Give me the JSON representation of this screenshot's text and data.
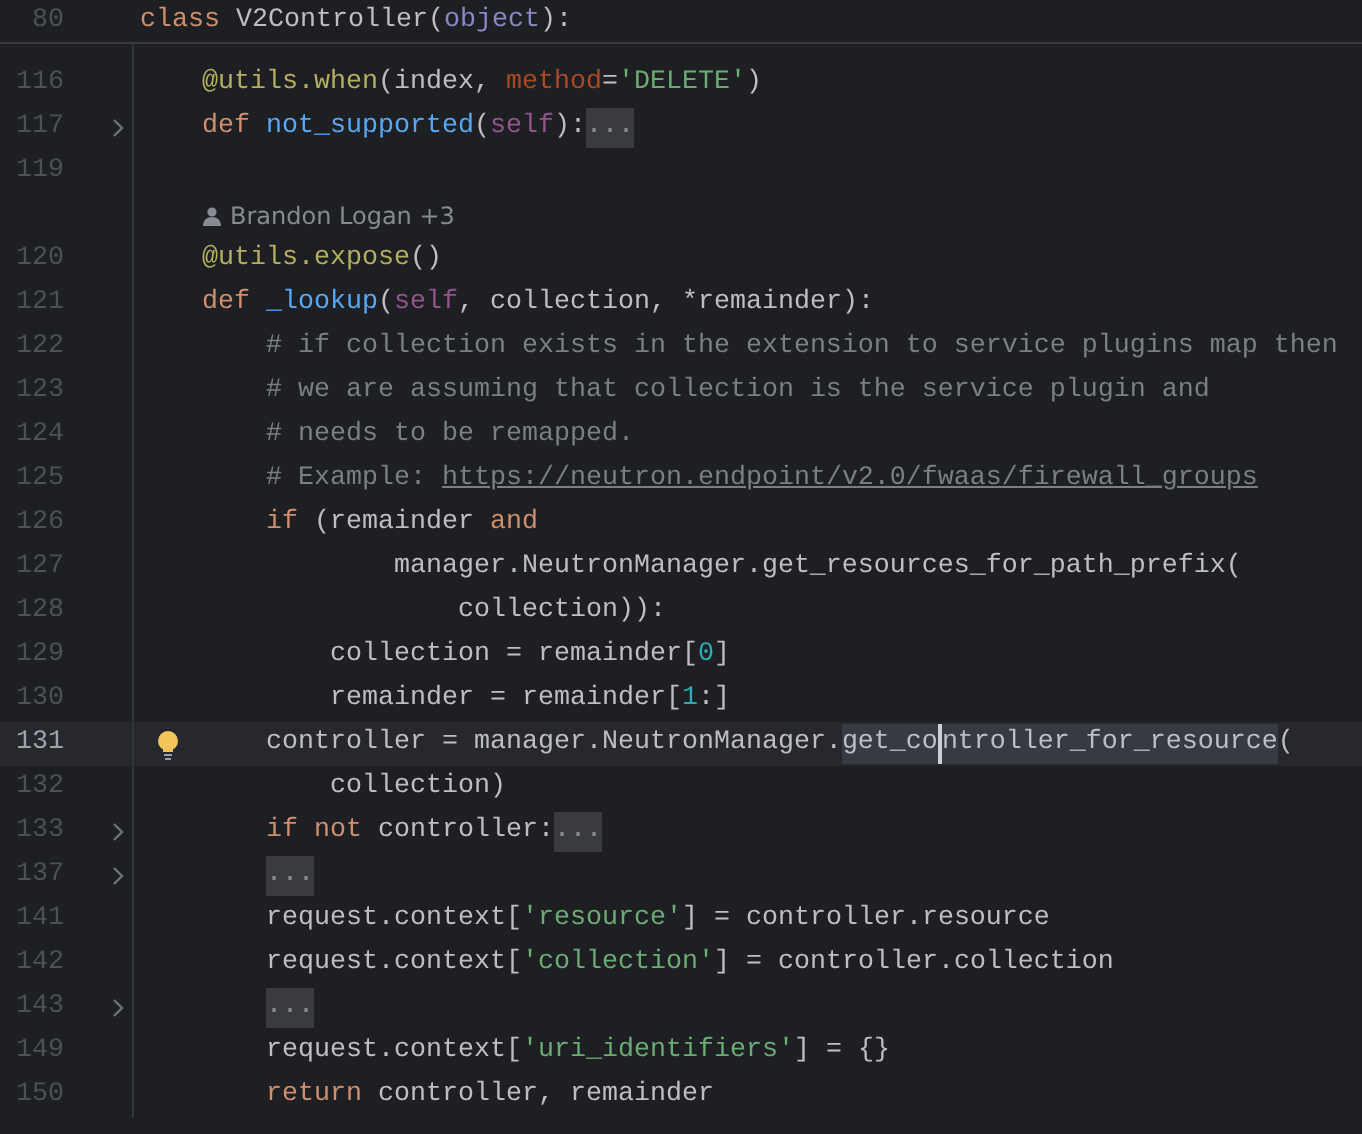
{
  "sticky_header": {
    "number": "80",
    "tokens": [
      {
        "text": "class ",
        "kind": "kw"
      },
      {
        "text": "V2Controller(",
        "kind": "plain"
      },
      {
        "text": "object",
        "kind": "builtin"
      },
      {
        "text": "):",
        "kind": "plain"
      }
    ]
  },
  "lines": [
    {
      "kind": "code",
      "number": "116",
      "fold": false,
      "current": false,
      "tokens": [
        {
          "text": "    @utils.when",
          "kind": "deco"
        },
        {
          "text": "(index, ",
          "kind": "plain"
        },
        {
          "text": "method",
          "kind": "param"
        },
        {
          "text": "=",
          "kind": "plain"
        },
        {
          "text": "'DELETE'",
          "kind": "str"
        },
        {
          "text": ")",
          "kind": "plain"
        }
      ]
    },
    {
      "kind": "code",
      "number": "117",
      "fold": true,
      "current": false,
      "tokens": [
        {
          "text": "    def ",
          "kind": "kw"
        },
        {
          "text": "not_supported",
          "kind": "fn"
        },
        {
          "text": "(",
          "kind": "plain"
        },
        {
          "text": "self",
          "kind": "self"
        },
        {
          "text": "):",
          "kind": "plain"
        },
        {
          "text": "...",
          "kind": "folded"
        }
      ]
    },
    {
      "kind": "code",
      "number": "119",
      "fold": false,
      "current": false
    },
    {
      "kind": "author",
      "text": "Brandon Logan +3"
    },
    {
      "kind": "code",
      "number": "120",
      "fold": false,
      "current": false,
      "tokens": [
        {
          "text": "    @utils.expose",
          "kind": "deco"
        },
        {
          "text": "()",
          "kind": "plain"
        }
      ]
    },
    {
      "kind": "code",
      "number": "121",
      "fold": false,
      "current": false,
      "tokens": [
        {
          "text": "    def ",
          "kind": "kw"
        },
        {
          "text": "_lookup",
          "kind": "fn"
        },
        {
          "text": "(",
          "kind": "plain"
        },
        {
          "text": "self",
          "kind": "self"
        },
        {
          "text": ", collection, *remainder):",
          "kind": "plain"
        }
      ]
    },
    {
      "kind": "code",
      "number": "122",
      "fold": false,
      "current": false,
      "tokens": [
        {
          "text": "        # if collection exists in the extension to service plugins map then",
          "kind": "comment"
        }
      ]
    },
    {
      "kind": "code",
      "number": "123",
      "fold": false,
      "current": false,
      "tokens": [
        {
          "text": "        # we are assuming that collection is the service plugin and",
          "kind": "comment"
        }
      ]
    },
    {
      "kind": "code",
      "number": "124",
      "fold": false,
      "current": false,
      "tokens": [
        {
          "text": "        # needs to be remapped.",
          "kind": "comment"
        }
      ]
    },
    {
      "kind": "code",
      "number": "125",
      "fold": false,
      "current": false,
      "tokens": [
        {
          "text": "        # Example: ",
          "kind": "comment"
        },
        {
          "text": "https://neutron.endpoint/v2.0/fwaas/firewall_groups",
          "kind": "link"
        }
      ]
    },
    {
      "kind": "code",
      "number": "126",
      "fold": false,
      "current": false,
      "tokens": [
        {
          "text": "        if ",
          "kind": "kw"
        },
        {
          "text": "(remainder ",
          "kind": "plain"
        },
        {
          "text": "and",
          "kind": "kw"
        }
      ]
    },
    {
      "kind": "code",
      "number": "127",
      "fold": false,
      "current": false,
      "tokens": [
        {
          "text": "                manager.NeutronManager.get_resources_for_path_prefix(",
          "kind": "plain"
        }
      ]
    },
    {
      "kind": "code",
      "number": "128",
      "fold": false,
      "current": false,
      "tokens": [
        {
          "text": "                    collection)):",
          "kind": "plain"
        }
      ]
    },
    {
      "kind": "code",
      "number": "129",
      "fold": false,
      "current": false,
      "tokens": [
        {
          "text": "            collection = remainder[",
          "kind": "plain"
        },
        {
          "text": "0",
          "kind": "num"
        },
        {
          "text": "]",
          "kind": "plain"
        }
      ]
    },
    {
      "kind": "code",
      "number": "130",
      "fold": false,
      "current": false,
      "tokens": [
        {
          "text": "            remainder = remainder[",
          "kind": "plain"
        },
        {
          "text": "1",
          "kind": "num"
        },
        {
          "text": ":]",
          "kind": "plain"
        }
      ]
    },
    {
      "kind": "code",
      "number": "131",
      "fold": false,
      "current": true,
      "tokens": [
        {
          "text": "        controller = manager.NeutronManager.",
          "kind": "plain"
        },
        {
          "text": "get_co",
          "kind": "usage"
        },
        {
          "text": "ntroller_for_resource",
          "kind": "usage_caret"
        },
        {
          "text": "(",
          "kind": "plain"
        }
      ]
    },
    {
      "kind": "code",
      "number": "132",
      "fold": false,
      "current": false,
      "tokens": [
        {
          "text": "            collection)",
          "kind": "plain"
        }
      ]
    },
    {
      "kind": "code",
      "number": "133",
      "fold": true,
      "current": false,
      "tokens": [
        {
          "text": "        if not ",
          "kind": "kw"
        },
        {
          "text": "controller:",
          "kind": "plain"
        },
        {
          "text": "...",
          "kind": "folded"
        }
      ]
    },
    {
      "kind": "code",
      "number": "137",
      "fold": true,
      "current": false,
      "tokens": [
        {
          "text": "        ...",
          "kind": "folded"
        }
      ]
    },
    {
      "kind": "code",
      "number": "141",
      "fold": false,
      "current": false,
      "tokens": [
        {
          "text": "        request.context[",
          "kind": "plain"
        },
        {
          "text": "'resource'",
          "kind": "str"
        },
        {
          "text": "] = controller.resource",
          "kind": "plain"
        }
      ]
    },
    {
      "kind": "code",
      "number": "142",
      "fold": false,
      "current": false,
      "tokens": [
        {
          "text": "        request.context[",
          "kind": "plain"
        },
        {
          "text": "'collection'",
          "kind": "str"
        },
        {
          "text": "] = controller.collection",
          "kind": "plain"
        }
      ]
    },
    {
      "kind": "code",
      "number": "143",
      "fold": true,
      "current": false,
      "tokens": [
        {
          "text": "        ...",
          "kind": "folded"
        }
      ]
    },
    {
      "kind": "code",
      "number": "149",
      "fold": false,
      "current": false,
      "tokens": [
        {
          "text": "        request.context[",
          "kind": "plain"
        },
        {
          "text": "'uri_identifiers'",
          "kind": "str"
        },
        {
          "text": "] = {}",
          "kind": "plain"
        }
      ]
    },
    {
      "kind": "code",
      "number": "150",
      "fold": false,
      "current": false,
      "tokens": [
        {
          "text": "        return ",
          "kind": "kw"
        },
        {
          "text": "controller, remainder",
          "kind": "plain"
        }
      ]
    }
  ]
}
